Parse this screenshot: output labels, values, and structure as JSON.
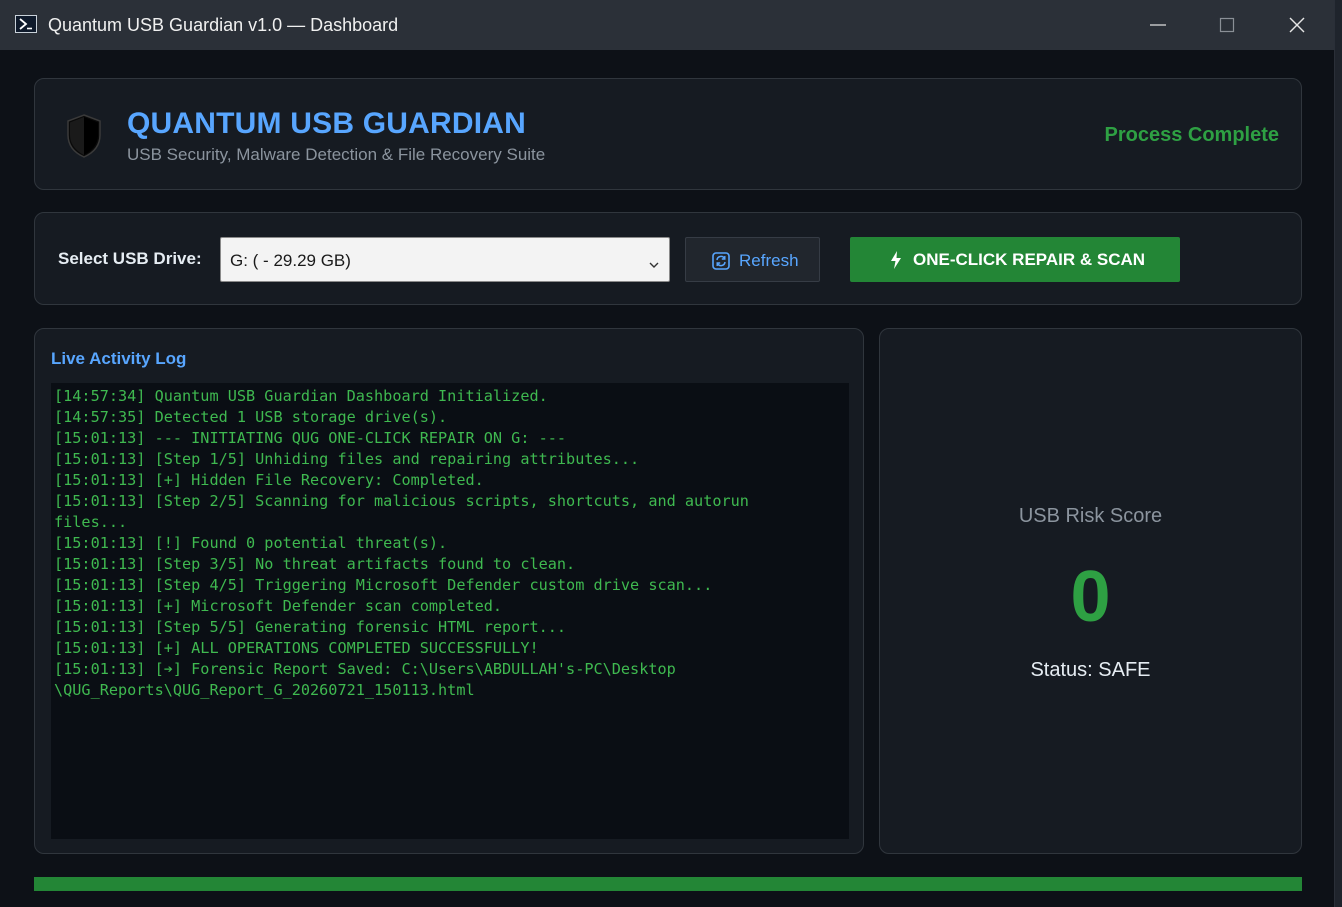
{
  "window": {
    "title": "Quantum USB Guardian v1.0 — Dashboard"
  },
  "header": {
    "app_name": "QUANTUM USB GUARDIAN",
    "subtitle": "USB Security, Malware Detection & File Recovery Suite",
    "process_status": "Process Complete"
  },
  "controls": {
    "drive_label": "Select USB Drive:",
    "selected_drive": "G: ( - 29.29 GB)",
    "refresh_label": "Refresh",
    "repair_label": "ONE-CLICK REPAIR & SCAN"
  },
  "log": {
    "title": "Live Activity Log",
    "lines": [
      "[14:57:34] Quantum USB Guardian Dashboard Initialized.",
      "[14:57:35] Detected 1 USB storage drive(s).",
      "[15:01:13] --- INITIATING QUG ONE-CLICK REPAIR ON G: ---",
      "[15:01:13] [Step 1/5] Unhiding files and repairing attributes...",
      "[15:01:13] [+] Hidden File Recovery: Completed.",
      "[15:01:13] [Step 2/5] Scanning for malicious scripts, shortcuts, and autorun",
      "files...",
      "[15:01:13] [!] Found 0 potential threat(s).",
      "[15:01:13] [Step 3/5] No threat artifacts found to clean.",
      "[15:01:13] [Step 4/5] Triggering Microsoft Defender custom drive scan...",
      "[15:01:13] [+] Microsoft Defender scan completed.",
      "[15:01:13] [Step 5/5] Generating forensic HTML report...",
      "[15:01:13] [+] ALL OPERATIONS COMPLETED SUCCESSFULLY!",
      "[15:01:13] [➔] Forensic Report Saved: C:\\Users\\ABDULLAH's-PC\\Desktop",
      "\\QUG_Reports\\QUG_Report_G_20260721_150113.html"
    ]
  },
  "risk": {
    "label": "USB Risk Score",
    "score": "0",
    "status": "Status: SAFE"
  },
  "progress": {
    "percent": 100
  },
  "icons": {
    "app": "powershell-icon",
    "shield": "shield-icon",
    "refresh": "refresh-icon",
    "repair": "lightning-icon",
    "dropdown": "chevron-down-icon"
  },
  "colors": {
    "accent_blue": "#58a6ff",
    "success_green": "#2ea043",
    "button_green": "#238636",
    "log_green": "#3fb950"
  }
}
